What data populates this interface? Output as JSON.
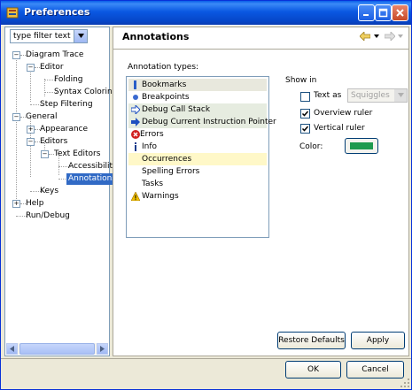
{
  "window": {
    "title": "Preferences"
  },
  "filter": {
    "placeholder": "type filter text"
  },
  "tree": [
    {
      "label": "Diagram Trace"
    },
    {
      "label": "Editor"
    },
    {
      "label": "Folding"
    },
    {
      "label": "Syntax Coloring"
    },
    {
      "label": "Step Filtering"
    },
    {
      "label": "General"
    },
    {
      "label": "Appearance"
    },
    {
      "label": "Editors"
    },
    {
      "label": "Text Editors"
    },
    {
      "label": "Accessibility"
    },
    {
      "label": "Annotations"
    },
    {
      "label": "Keys"
    },
    {
      "label": "Help"
    },
    {
      "label": "Run/Debug"
    }
  ],
  "page": {
    "title": "Annotations"
  },
  "annotations": {
    "label": "Annotation types:",
    "items": [
      {
        "label": "Bookmarks"
      },
      {
        "label": "Breakpoints"
      },
      {
        "label": "Debug Call Stack"
      },
      {
        "label": "Debug Current Instruction Pointer"
      },
      {
        "label": "Errors"
      },
      {
        "label": "Info"
      },
      {
        "label": "Occurrences"
      },
      {
        "label": "Spelling Errors"
      },
      {
        "label": "Tasks"
      },
      {
        "label": "Warnings"
      }
    ]
  },
  "show_in": {
    "label": "Show in",
    "text_as": {
      "label": "Text as",
      "checked": false,
      "value": "Squiggles"
    },
    "overview_ruler": {
      "label": "Overview ruler",
      "checked": true
    },
    "vertical_ruler": {
      "label": "Vertical ruler",
      "checked": true
    },
    "color_label": "Color:",
    "color": "#1e9a4e"
  },
  "buttons": {
    "restore": "Restore Defaults",
    "apply": "Apply",
    "ok": "OK",
    "cancel": "Cancel"
  }
}
